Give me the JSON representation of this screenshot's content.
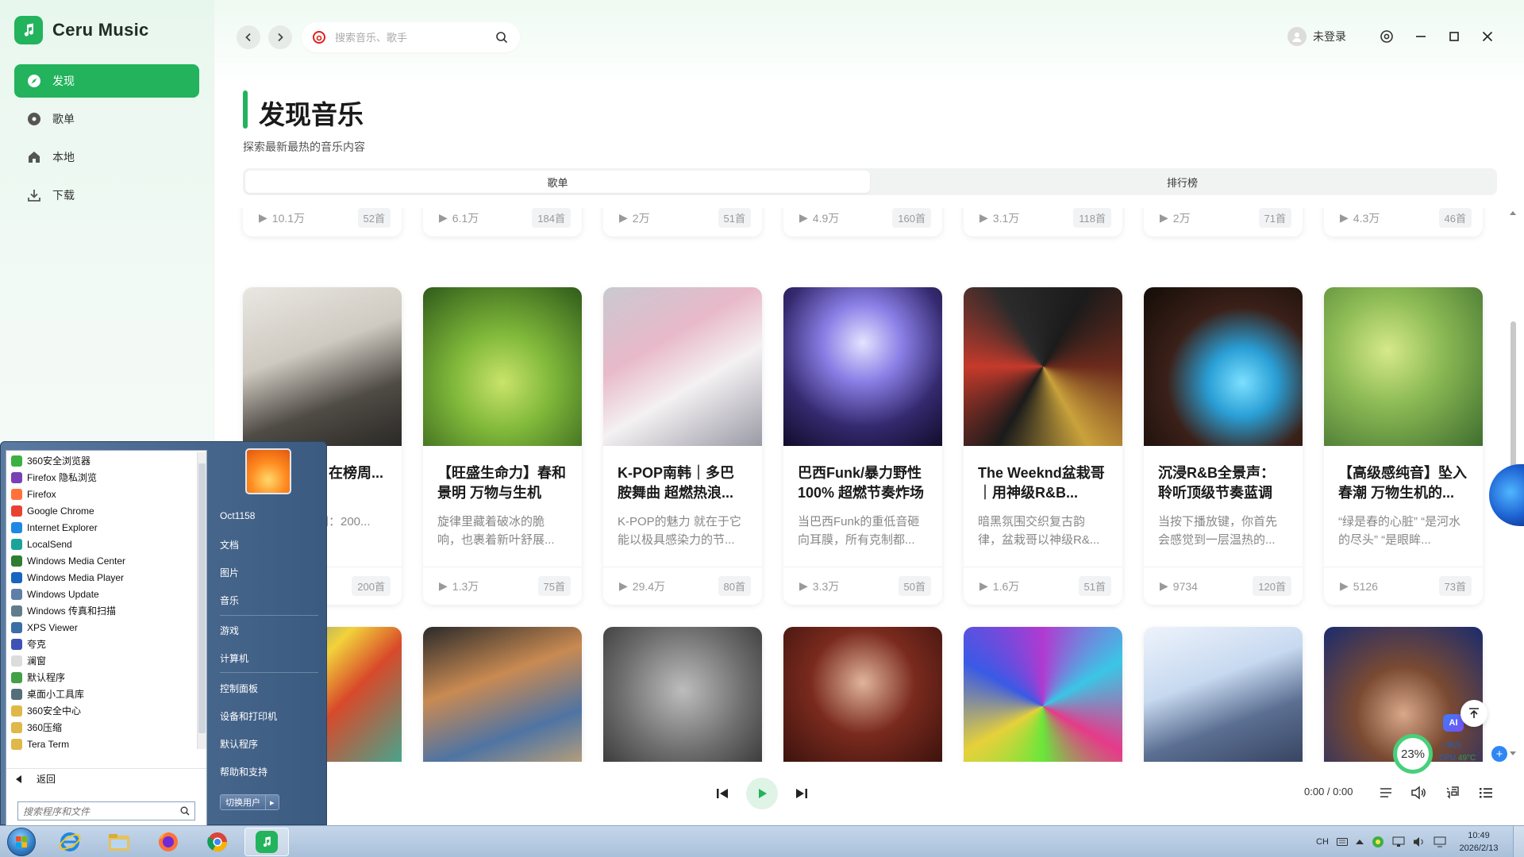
{
  "app": {
    "name": "Ceru Music",
    "brand_color": "#22b35c",
    "nav": [
      {
        "label": "发现",
        "icon": "compass-icon",
        "active": true
      },
      {
        "label": "歌单",
        "icon": "disc-icon",
        "active": false
      },
      {
        "label": "本地",
        "icon": "home-icon",
        "active": false
      },
      {
        "label": "下载",
        "icon": "download-icon",
        "active": false
      }
    ]
  },
  "topbar": {
    "search_placeholder": "搜索音乐、歌手",
    "user_label": "未登录"
  },
  "page": {
    "title": "发现音乐",
    "subtitle": "探索最新最热的音乐内容",
    "tabs": [
      {
        "label": "歌单",
        "active": true
      },
      {
        "label": "排行榜",
        "active": false
      }
    ]
  },
  "cards_row1": [
    {
      "plays": "10.1万",
      "songs": "52首"
    },
    {
      "plays": "6.1万",
      "songs": "184首"
    },
    {
      "plays": "2万",
      "songs": "51首"
    },
    {
      "plays": "4.9万",
      "songs": "160首"
    },
    {
      "plays": "3.1万",
      "songs": "118首"
    },
    {
      "plays": "2万",
      "songs": "71首"
    },
    {
      "plays": "4.3万",
      "songs": "46首"
    }
  ],
  "cards_row2": [
    {
      "title": "日本歌曲｜在榜周...",
      "desc": "据本人自行间：200...",
      "plays": "",
      "songs": "200首"
    },
    {
      "title": "【旺盛生命力】春和景明 万物与生机",
      "desc": "旋律里藏着破冰的脆响，也裹着新叶舒展...",
      "plays": "1.3万",
      "songs": "75首"
    },
    {
      "title": "K-POP南韩｜多巴胺舞曲 超燃热浪...",
      "desc": "K-POP的魅力 就在于它能以极具感染力的节...",
      "plays": "29.4万",
      "songs": "80首"
    },
    {
      "title": "巴西Funk/暴力野性100% 超燃节奏炸场",
      "desc": "当巴西Funk的重低音砸向耳膜，所有克制都...",
      "plays": "3.3万",
      "songs": "50首"
    },
    {
      "title": "The Weeknd盆栽哥｜用神级R&B...",
      "desc": "暗黑氛围交织复古韵律，盆栽哥以神级R&...",
      "plays": "1.6万",
      "songs": "51首"
    },
    {
      "title": "沉浸R&B全景声：聆听顶级节奏蓝调",
      "desc": "当按下播放键，你首先会感觉到一层温热的...",
      "plays": "9734",
      "songs": "120首"
    },
    {
      "title": "【高级感纯音】坠入春潮 万物生机的...",
      "desc": "“绿是春的心脏” “是河水的尽头” “是眼眸...",
      "plays": "5126",
      "songs": "73首"
    }
  ],
  "player": {
    "time": "0:00 / 0:00"
  },
  "monitor": {
    "cpu_percent": "23%",
    "net": "0K/s",
    "cpu_temp_label": "CPU",
    "cpu_temp": "49°C"
  },
  "ai_label": "AI",
  "startmenu": {
    "programs": [
      {
        "label": "360安全浏览器",
        "color": "#3cb043"
      },
      {
        "label": "Firefox 隐私浏览",
        "color": "#7b3fb5"
      },
      {
        "label": "Firefox",
        "color": "#ff7139"
      },
      {
        "label": "Google Chrome",
        "color": "#e94235"
      },
      {
        "label": "Internet Explorer",
        "color": "#1e88e5"
      },
      {
        "label": "LocalSend",
        "color": "#1aa39a"
      },
      {
        "label": "Windows Media Center",
        "color": "#2e7d32"
      },
      {
        "label": "Windows Media Player",
        "color": "#1565c0"
      },
      {
        "label": "Windows Update",
        "color": "#5f7fa8"
      },
      {
        "label": "Windows 传真和扫描",
        "color": "#607d8b"
      },
      {
        "label": "XPS Viewer",
        "color": "#3a6ea5"
      },
      {
        "label": "夸克",
        "color": "#3f51b5"
      },
      {
        "label": "澜窗",
        "color": "#dcdcdc"
      },
      {
        "label": "默认程序",
        "color": "#43a047"
      },
      {
        "label": "桌面小工具库",
        "color": "#546e7a"
      },
      {
        "label": "360安全中心",
        "color": "#e0b84a"
      },
      {
        "label": "360压缩",
        "color": "#e0b84a"
      },
      {
        "label": "Tera Term",
        "color": "#e0b84a"
      }
    ],
    "back_label": "返回",
    "search_placeholder": "搜索程序和文件",
    "right_items": [
      "Oct1158",
      "文档",
      "图片",
      "音乐",
      "游戏",
      "计算机",
      "控制面板",
      "设备和打印机",
      "默认程序",
      "帮助和支持"
    ],
    "switch_user": "切换用户"
  },
  "taskbar": {
    "tray_lang": "CH",
    "clock_time": "10:49",
    "clock_date": "2026/2/13"
  }
}
